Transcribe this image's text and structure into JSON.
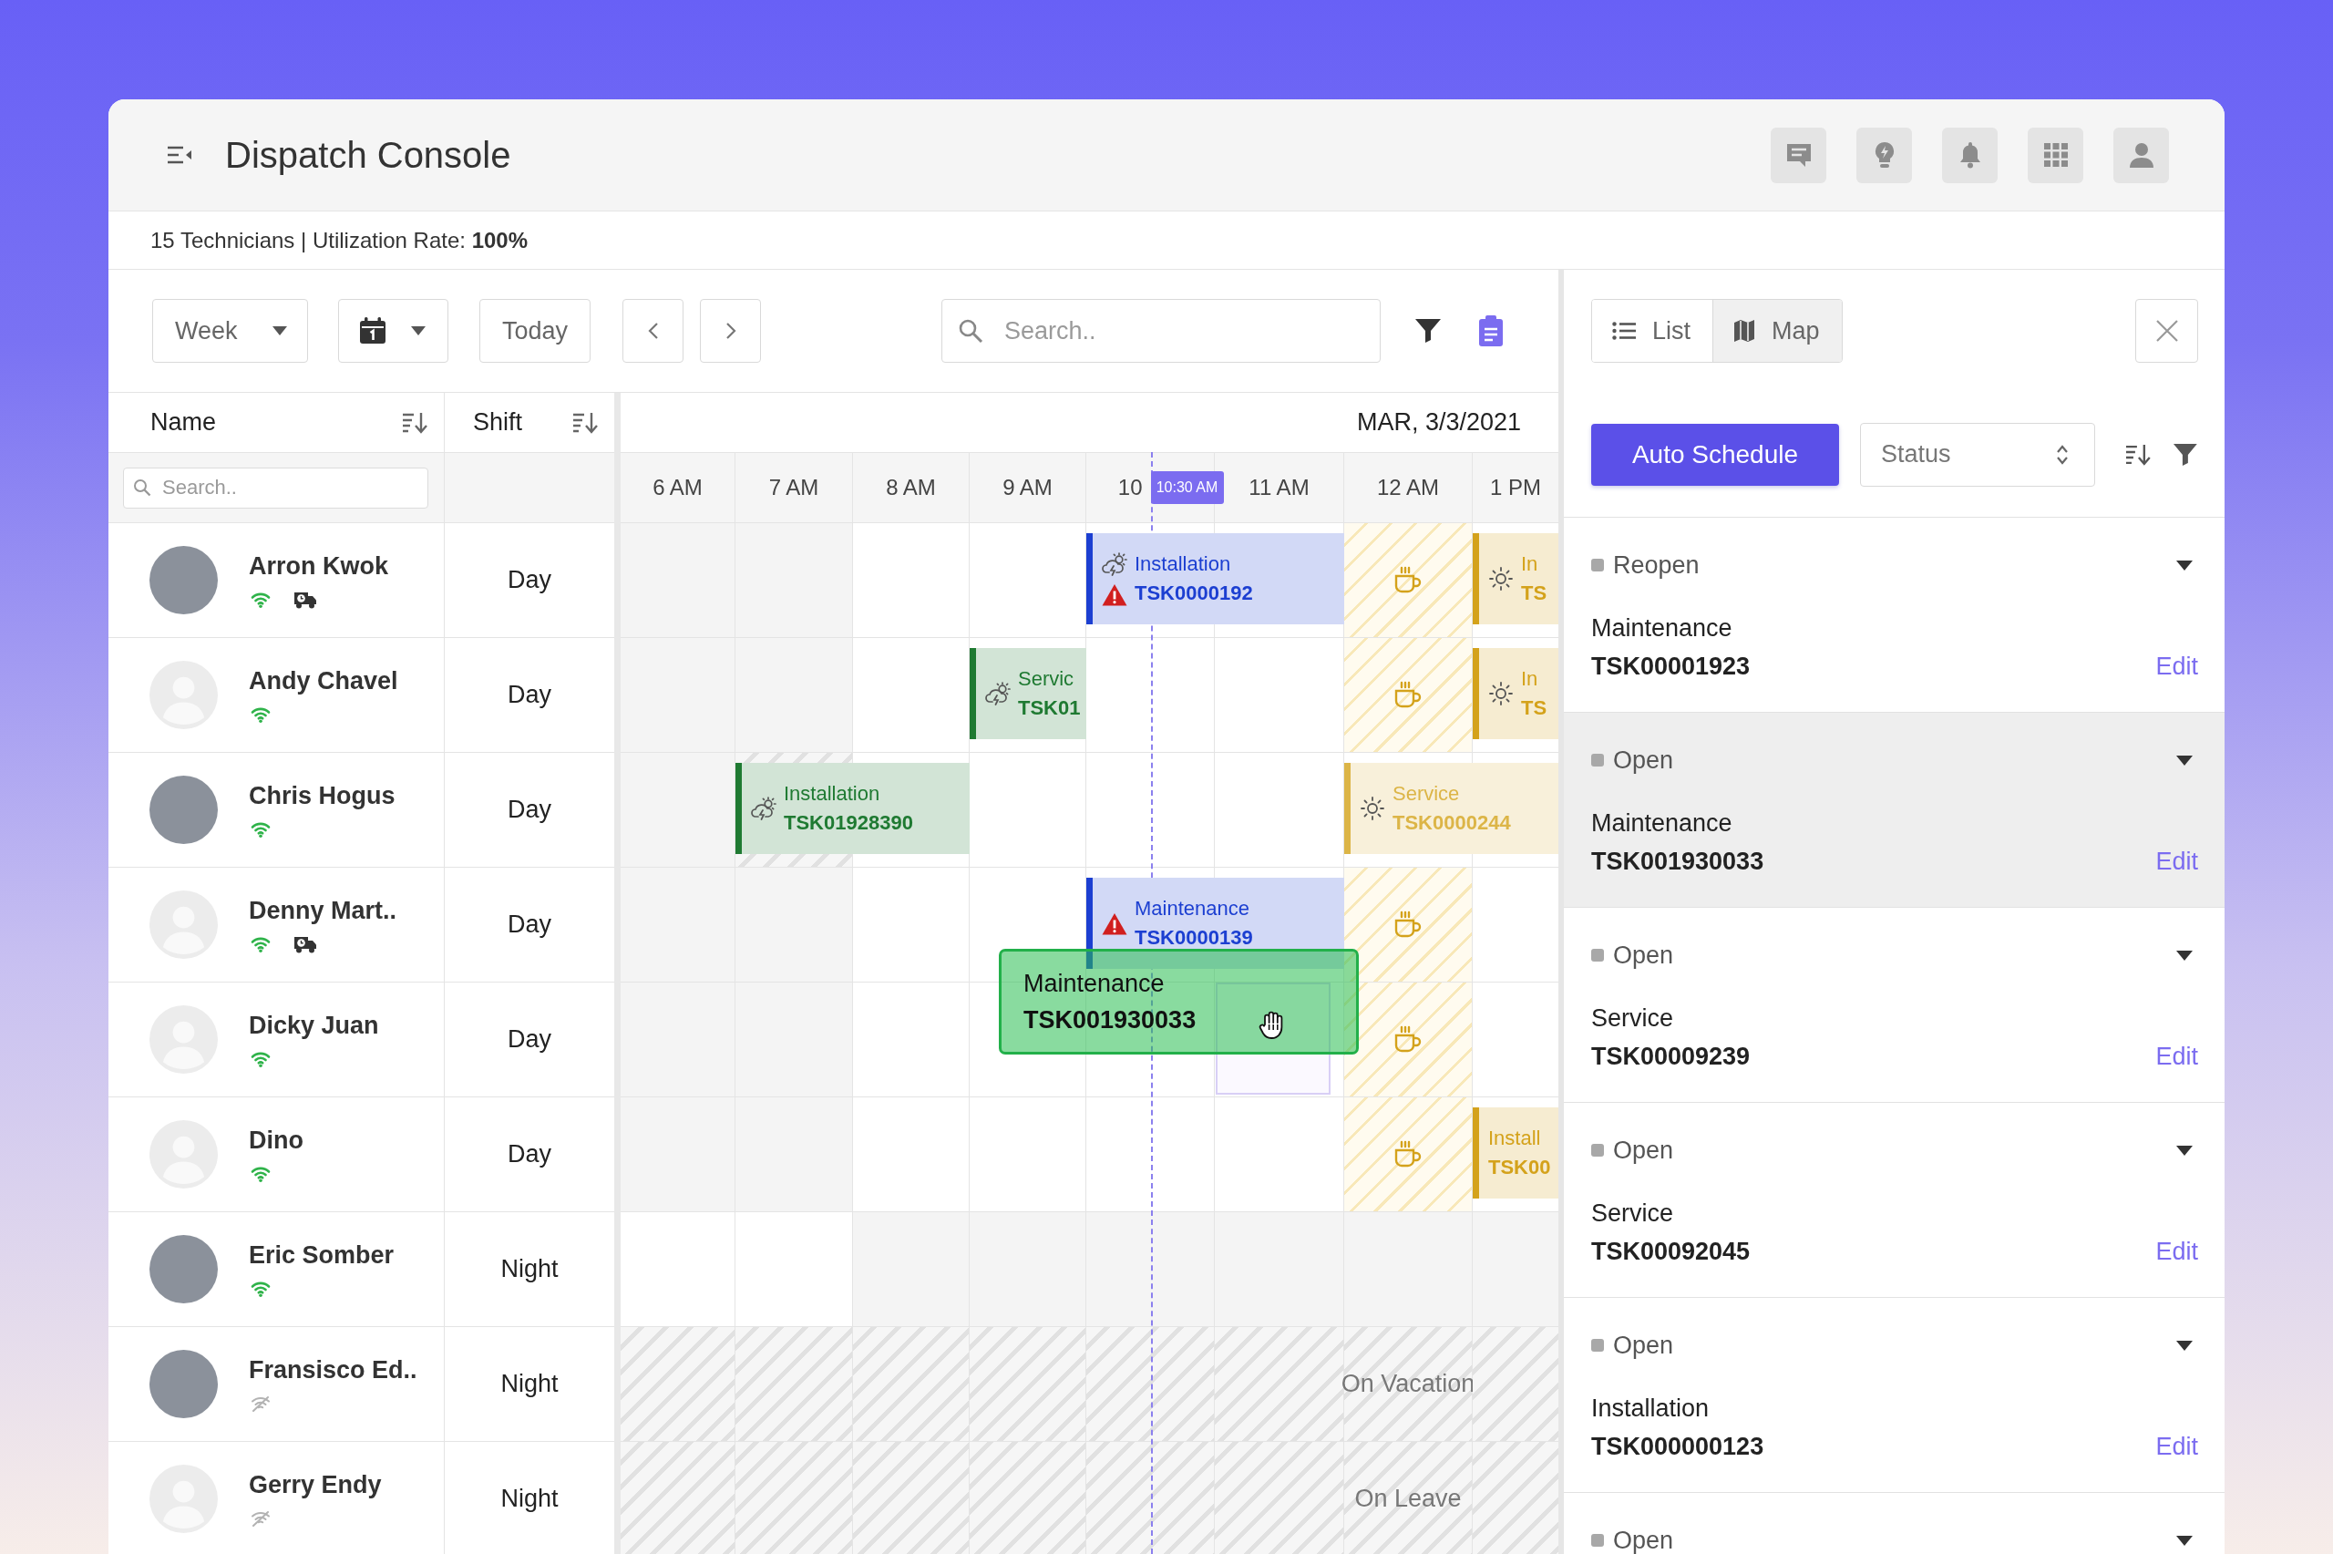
{
  "app": {
    "title": "Dispatch Console"
  },
  "summary": "15 Technicians | Utilization Rate: **100%**",
  "toolbar": {
    "range": "Week",
    "today": "Today",
    "search": {
      "placeholder": "Search.."
    }
  },
  "grid": {
    "columns": [
      "Name",
      "Shift"
    ],
    "name_search": {
      "placeholder": "Search.."
    },
    "date": "MAR, 3/3/2021",
    "hours": [
      "6 AM",
      "7 AM",
      "8 AM",
      "9 AM",
      "10",
      "11 AM",
      "12 AM",
      "1 PM"
    ],
    "now": "10:30 AM"
  },
  "technicians": [
    {
      "name": "Arron Kwok",
      "shift": "Day",
      "photo": true,
      "online": true,
      "vehicle": true,
      "cells": [
        {
          "kind": "off"
        },
        {
          "kind": "off"
        },
        {
          "kind": "open"
        },
        {
          "kind": "open"
        },
        {
          "kind": "open",
          "task": {
            "type": "Installation",
            "code": "TSK0000192",
            "color": "#1c3fd1",
            "icons": [
              {
                "kind": "storm"
              },
              {
                "kind": "warning"
              }
            ]
          }
        },
        {
          "kind": "occupied"
        },
        {
          "kind": "break"
        },
        {
          "kind": "open",
          "task": {
            "type": "In",
            "code": "TS",
            "color": "#d4a21b",
            "icons": [
              {
                "kind": "sun"
              }
            ]
          }
        }
      ]
    },
    {
      "name": "Andy Chavel",
      "shift": "Day",
      "photo": false,
      "online": true,
      "cells": [
        {
          "kind": "off"
        },
        {
          "kind": "off"
        },
        {
          "kind": "open"
        },
        {
          "kind": "open",
          "task": {
            "type": "Servic",
            "code": "TSK01",
            "color": "#1f7a32",
            "icons": [
              {
                "kind": "storm"
              }
            ]
          }
        },
        {
          "kind": "open"
        },
        {
          "kind": "open"
        },
        {
          "kind": "break"
        },
        {
          "kind": "open",
          "task": {
            "type": "In",
            "code": "TS",
            "color": "#d4a21b",
            "icons": [
              {
                "kind": "sun"
              }
            ]
          }
        }
      ]
    },
    {
      "name": "Chris Hogus",
      "shift": "Day",
      "photo": true,
      "online": true,
      "cells": [
        {
          "kind": "off"
        },
        {
          "kind": "blocked",
          "task": {
            "type": "Installation",
            "code": "TSK01928390",
            "color": "#1f7a32",
            "icons": [
              {
                "kind": "storm"
              }
            ]
          }
        },
        {
          "kind": "occupied"
        },
        {
          "kind": "open"
        },
        {
          "kind": "open"
        },
        {
          "kind": "open"
        },
        {
          "kind": "open",
          "task": {
            "type": "Service",
            "code": "TSK0000244",
            "color": "#dcb547",
            "icons": [
              {
                "kind": "sun"
              }
            ]
          }
        },
        {
          "kind": "occupied"
        }
      ]
    },
    {
      "name": "Denny Mart..",
      "shift": "Day",
      "photo": false,
      "online": true,
      "vehicle": true,
      "cells": [
        {
          "kind": "off"
        },
        {
          "kind": "off"
        },
        {
          "kind": "open"
        },
        {
          "kind": "open"
        },
        {
          "kind": "open",
          "task": {
            "type": "Maintenance",
            "code": "TSK0000139",
            "color": "#1c3fd1",
            "icons": [
              {
                "kind": "warning"
              }
            ]
          }
        },
        {
          "kind": "occupied"
        },
        {
          "kind": "break"
        },
        {
          "kind": "open"
        }
      ]
    },
    {
      "name": "Dicky Juan",
      "shift": "Day",
      "photo": false,
      "online": true,
      "cells": [
        {
          "kind": "off"
        },
        {
          "kind": "off"
        },
        {
          "kind": "open"
        },
        {
          "kind": "open"
        },
        {
          "kind": "open"
        },
        {
          "kind": "drop",
          "drag": {
            "type": "Maintenance",
            "code": "TSK001930033"
          }
        },
        {
          "kind": "break"
        },
        {
          "kind": "open"
        }
      ]
    },
    {
      "name": "Dino",
      "shift": "Day",
      "photo": false,
      "online": true,
      "cells": [
        {
          "kind": "off"
        },
        {
          "kind": "off"
        },
        {
          "kind": "open"
        },
        {
          "kind": "open"
        },
        {
          "kind": "open"
        },
        {
          "kind": "open"
        },
        {
          "kind": "break"
        },
        {
          "kind": "open",
          "task": {
            "type": "Install",
            "code": "TSK00",
            "color": "#d4a21b"
          }
        }
      ]
    },
    {
      "name": "Eric Somber",
      "shift": "Night",
      "photo": true,
      "online": true,
      "cells": [
        {
          "kind": "open"
        },
        {
          "kind": "open"
        },
        {
          "kind": "off"
        },
        {
          "kind": "off"
        },
        {
          "kind": "off"
        },
        {
          "kind": "off"
        },
        {
          "kind": "off"
        },
        {
          "kind": "off"
        }
      ]
    },
    {
      "name": "Fransisco Ed..",
      "shift": "Night",
      "photo": true,
      "online": false,
      "cells": [
        {
          "kind": "blocked"
        },
        {
          "kind": "blocked"
        },
        {
          "kind": "blocked"
        },
        {
          "kind": "blocked"
        },
        {
          "kind": "blocked"
        },
        {
          "kind": "blocked"
        },
        {
          "kind": "blocked",
          "label": "On Vacation"
        },
        {
          "kind": "blocked"
        }
      ]
    },
    {
      "name": "Gerry Endy",
      "shift": "Night",
      "photo": false,
      "online": false,
      "cells": [
        {
          "kind": "blocked"
        },
        {
          "kind": "blocked"
        },
        {
          "kind": "blocked"
        },
        {
          "kind": "blocked"
        },
        {
          "kind": "blocked"
        },
        {
          "kind": "blocked"
        },
        {
          "kind": "blocked",
          "label": "On Leave"
        },
        {
          "kind": "blocked"
        }
      ]
    }
  ],
  "panel": {
    "views": [
      {
        "label": "List",
        "selected": true
      },
      {
        "label": "Map",
        "selected": false
      }
    ],
    "auto_schedule": "Auto Schedule",
    "status_filter": "Status",
    "tasks": [
      {
        "status": "Reopen",
        "type": "Maintenance",
        "code": "TSK00001923",
        "action": "Edit",
        "selected": false
      },
      {
        "status": "Open",
        "type": "Maintenance",
        "code": "TSK001930033",
        "action": "Edit",
        "selected": true
      },
      {
        "status": "Open",
        "type": "Service",
        "code": "TSK00009239",
        "action": "Edit",
        "selected": false
      },
      {
        "status": "Open",
        "type": "Service",
        "code": "TSK00092045",
        "action": "Edit",
        "selected": false
      },
      {
        "status": "Open",
        "type": "Installation",
        "code": "TSK000000123",
        "action": "Edit",
        "selected": false
      },
      {
        "status": "Open",
        "selected": false
      }
    ]
  }
}
